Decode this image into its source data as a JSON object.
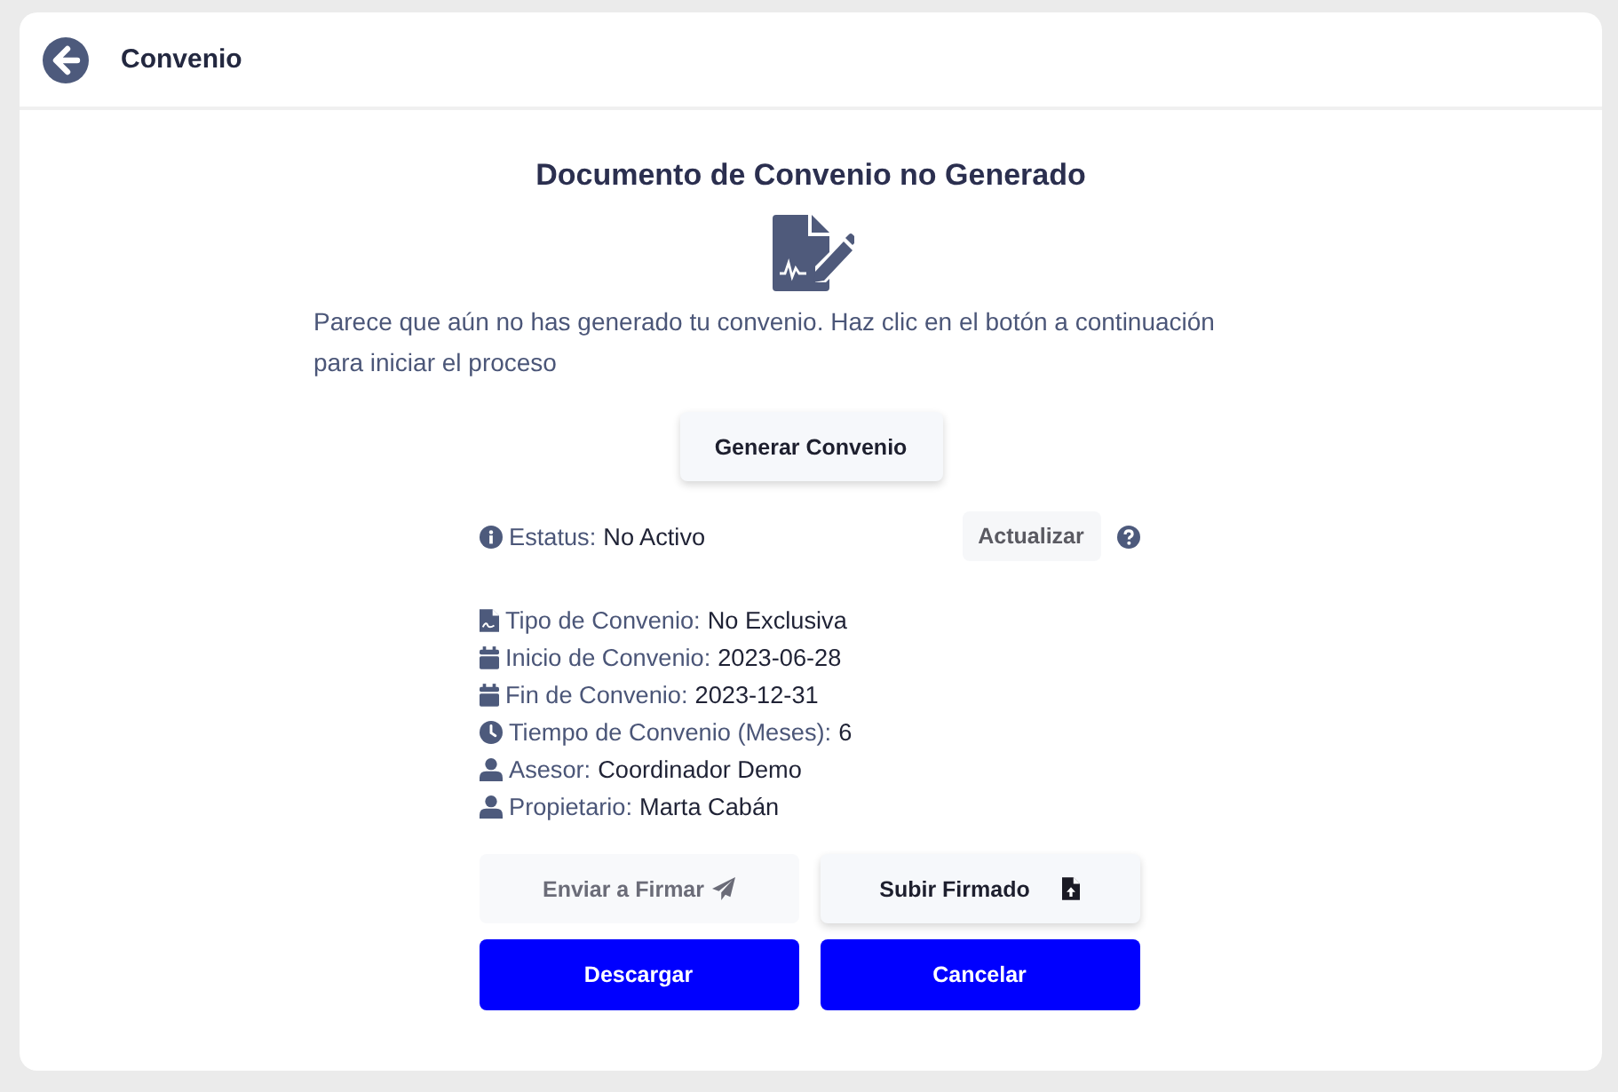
{
  "header": {
    "title": "Convenio"
  },
  "notice": {
    "title": "Documento de Convenio no Generado",
    "message": "Parece que aún no has generado tu convenio. Haz clic en el botón a continuación para iniciar el proceso"
  },
  "generate_button": {
    "label": "Generar Convenio"
  },
  "status": {
    "label": "Estatus:",
    "value": "No Activo",
    "refresh_button": "Actualizar"
  },
  "details": [
    {
      "kind": "type",
      "label": "Tipo de Convenio:",
      "value": "No Exclusiva"
    },
    {
      "kind": "date",
      "label": "Inicio de Convenio:",
      "value": "2023-06-28"
    },
    {
      "kind": "date",
      "label": "Fin de Convenio:",
      "value": "2023-12-31"
    },
    {
      "kind": "duration",
      "label": "Tiempo de Convenio (Meses):",
      "value": "6"
    },
    {
      "kind": "person",
      "label": "Asesor:",
      "value": "Coordinador Demo"
    },
    {
      "kind": "person",
      "label": "Propietario:",
      "value": "Marta Cabán"
    }
  ],
  "actions": [
    {
      "kind": "send",
      "label": "Enviar a Firmar",
      "disabled": true
    },
    {
      "kind": "upload",
      "label": "Subir Firmado",
      "disabled": false
    },
    {
      "kind": "download",
      "label": "Descargar",
      "disabled": false
    },
    {
      "kind": "cancel",
      "label": "Cancelar",
      "disabled": false
    }
  ]
}
